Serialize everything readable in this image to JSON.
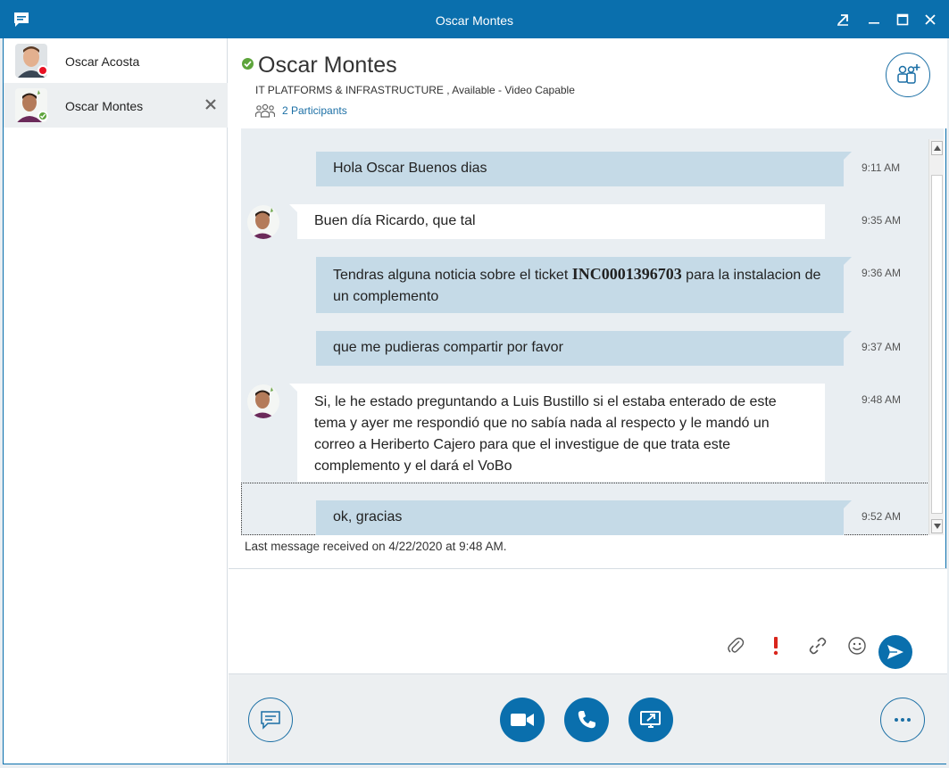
{
  "window": {
    "title": "Oscar Montes"
  },
  "sidebar": {
    "items": [
      {
        "name": "Oscar Acosta",
        "presence": "busy"
      },
      {
        "name": "Oscar Montes",
        "presence": "available"
      }
    ]
  },
  "header": {
    "name": "Oscar Montes",
    "subtitle": "IT PLATFORMS & INFRASTRUCTURE , Available - Video Capable",
    "participants": "2 Participants"
  },
  "messages": [
    {
      "sender": "me",
      "text": "Hola Oscar Buenos dias",
      "time": "9:11 AM"
    },
    {
      "sender": "them",
      "text": "Buen día Ricardo, que tal",
      "time": "9:35 AM"
    },
    {
      "sender": "me",
      "text_before": "Tendras alguna noticia sobre el ticket ",
      "ticket": "INC0001396703",
      "text_after": " para la instalacion de un complemento",
      "time": "9:36 AM"
    },
    {
      "sender": "me",
      "text": "que me pudieras compartir por favor",
      "time": "9:37 AM"
    },
    {
      "sender": "them",
      "text": "Si, le he estado preguntando a Luis Bustillo si el estaba enterado de este tema y ayer me respondió que no sabía nada al respecto y le mandó un correo a Heriberto Cajero para que el investigue de que trata este complemento y el dará el VoBo",
      "time": "9:48 AM"
    },
    {
      "sender": "me",
      "text": "ok, gracias",
      "time": "9:52 AM"
    }
  ],
  "status": {
    "last_message": "Last message received on 4/22/2020 at 9:48 AM."
  },
  "colors": {
    "accent": "#0a6fad",
    "my_bubble": "#c5dae7",
    "their_bubble": "#ffffff",
    "available": "#5da43b",
    "busy": "#e81123",
    "important": "#d9251c"
  }
}
